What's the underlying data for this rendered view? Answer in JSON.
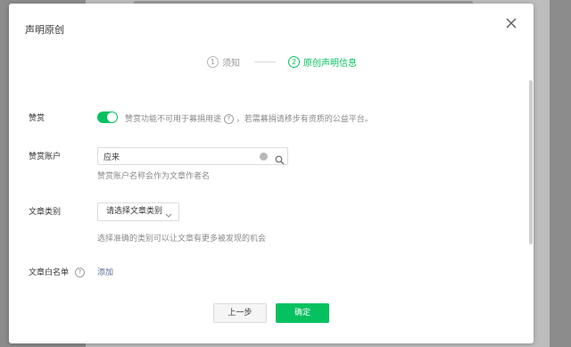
{
  "dialog": {
    "title": "声明原创",
    "close_icon": "close-icon"
  },
  "steps": [
    {
      "number": "1",
      "label": "须知",
      "state": "done"
    },
    {
      "number": "2",
      "label": "原创声明信息",
      "state": "active"
    }
  ],
  "reward": {
    "label": "赞赏",
    "enabled": true,
    "tip_before": "赞赏功能不可用于募捐用途",
    "tip_after": "，若需募捐请移步有资质的公益平台。",
    "help_glyph": "?"
  },
  "reward_account": {
    "label": "赞赏账户",
    "value": "应来",
    "hint": "赞赏账户名称会作为文章作者名"
  },
  "category": {
    "label": "文章类别",
    "selected": "请选择文章类别",
    "hint": "选择准确的类别可以让文章有更多被发现的机会"
  },
  "whitelist": {
    "label": "文章白名单",
    "help_glyph": "?",
    "add_link": "添加"
  },
  "footer": {
    "prev_label": "上一步",
    "confirm_label": "确定"
  },
  "colors": {
    "accent": "#07c160",
    "link": "#576b95"
  }
}
